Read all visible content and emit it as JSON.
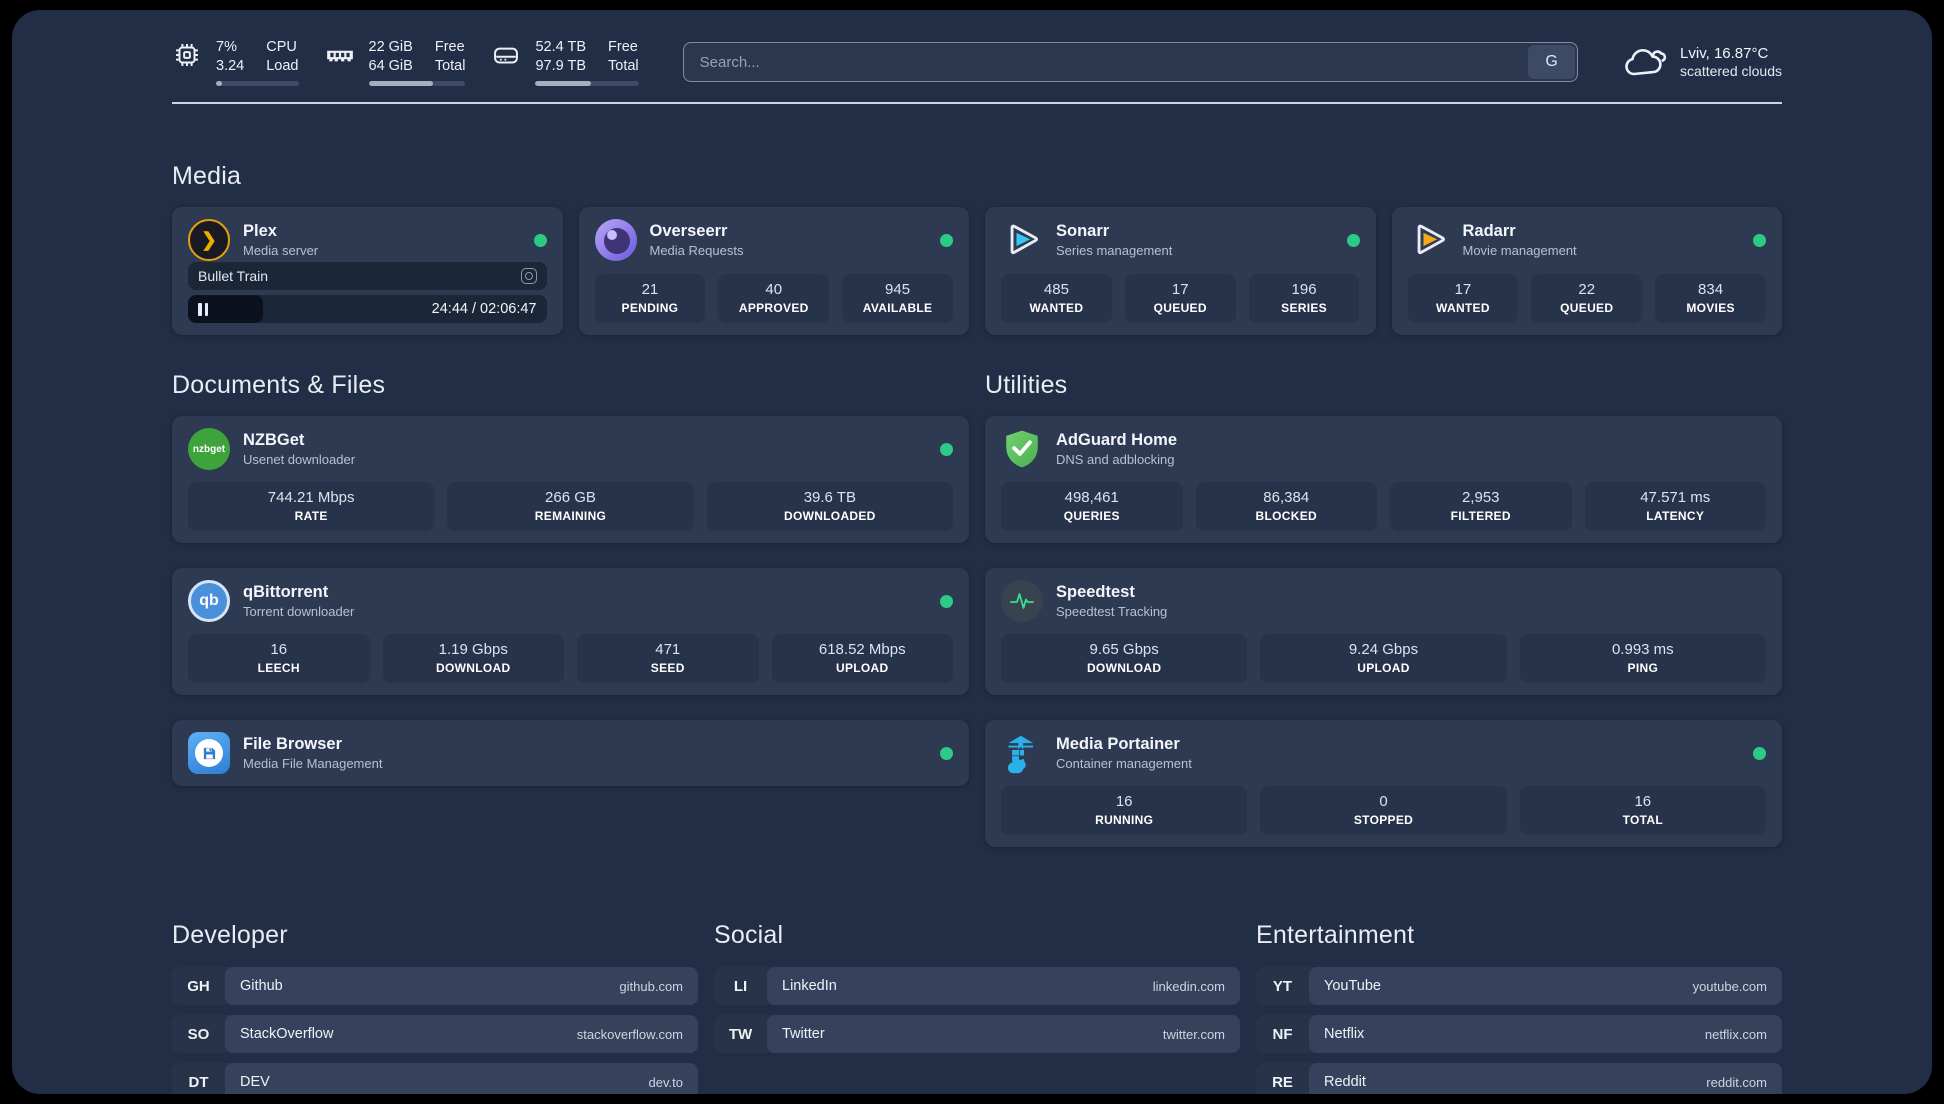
{
  "header": {
    "cpu": {
      "value_top": "7%",
      "value_bottom": "3.24",
      "label_top": "CPU",
      "label_bottom": "Load",
      "percent": 7
    },
    "ram": {
      "value_top": "22 GiB",
      "value_bottom": "64 GiB",
      "label_top": "Free",
      "label_bottom": "Total",
      "percent": 66
    },
    "disk": {
      "value_top": "52.4 TB",
      "value_bottom": "97.9 TB",
      "label_top": "Free",
      "label_bottom": "Total",
      "percent": 54
    },
    "search": {
      "placeholder": "Search...",
      "provider_label": "G"
    },
    "weather": {
      "location_temp": "Lviv, 16.87°C",
      "condition": "scattered clouds"
    }
  },
  "sections": {
    "media": "Media",
    "documents": "Documents & Files",
    "utilities": "Utilities",
    "developer": "Developer",
    "social": "Social",
    "entertainment": "Entertainment"
  },
  "cards": {
    "plex": {
      "name": "Plex",
      "desc": "Media server",
      "icon_glyph": "❯",
      "player": {
        "title": "Bullet Train",
        "time": "24:44 / 02:06:47",
        "progress_percent": 21
      }
    },
    "overseerr": {
      "name": "Overseerr",
      "desc": "Media Requests",
      "stats": [
        {
          "value": "21",
          "label": "PENDING"
        },
        {
          "value": "40",
          "label": "APPROVED"
        },
        {
          "value": "945",
          "label": "AVAILABLE"
        }
      ]
    },
    "sonarr": {
      "name": "Sonarr",
      "desc": "Series management",
      "stats": [
        {
          "value": "485",
          "label": "WANTED"
        },
        {
          "value": "17",
          "label": "QUEUED"
        },
        {
          "value": "196",
          "label": "SERIES"
        }
      ]
    },
    "radarr": {
      "name": "Radarr",
      "desc": "Movie management",
      "stats": [
        {
          "value": "17",
          "label": "WANTED"
        },
        {
          "value": "22",
          "label": "QUEUED"
        },
        {
          "value": "834",
          "label": "MOVIES"
        }
      ]
    },
    "nzbget": {
      "name": "NZBGet",
      "desc": "Usenet downloader",
      "icon_text": "nzbget",
      "stats": [
        {
          "value": "744.21 Mbps",
          "label": "RATE"
        },
        {
          "value": "266 GB",
          "label": "REMAINING"
        },
        {
          "value": "39.6 TB",
          "label": "DOWNLOADED"
        }
      ]
    },
    "qbittorrent": {
      "name": "qBittorrent",
      "desc": "Torrent downloader",
      "icon_text": "qb",
      "stats": [
        {
          "value": "16",
          "label": "LEECH"
        },
        {
          "value": "1.19 Gbps",
          "label": "DOWNLOAD"
        },
        {
          "value": "471",
          "label": "SEED"
        },
        {
          "value": "618.52 Mbps",
          "label": "UPLOAD"
        }
      ]
    },
    "filebrowser": {
      "name": "File Browser",
      "desc": "Media File Management"
    },
    "adguard": {
      "name": "AdGuard Home",
      "desc": "DNS and adblocking",
      "stats": [
        {
          "value": "498,461",
          "label": "QUERIES"
        },
        {
          "value": "86,384",
          "label": "BLOCKED"
        },
        {
          "value": "2,953",
          "label": "FILTERED"
        },
        {
          "value": "47.571 ms",
          "label": "LATENCY"
        }
      ]
    },
    "speedtest": {
      "name": "Speedtest",
      "desc": "Speedtest Tracking",
      "stats": [
        {
          "value": "9.65 Gbps",
          "label": "DOWNLOAD"
        },
        {
          "value": "9.24 Gbps",
          "label": "UPLOAD"
        },
        {
          "value": "0.993 ms",
          "label": "PING"
        }
      ]
    },
    "portainer": {
      "name": "Media Portainer",
      "desc": "Container management",
      "stats": [
        {
          "value": "16",
          "label": "RUNNING"
        },
        {
          "value": "0",
          "label": "STOPPED"
        },
        {
          "value": "16",
          "label": "TOTAL"
        }
      ]
    }
  },
  "bookmarks": {
    "developer": [
      {
        "abbr": "GH",
        "name": "Github",
        "url": "github.com"
      },
      {
        "abbr": "SO",
        "name": "StackOverflow",
        "url": "stackoverflow.com"
      },
      {
        "abbr": "DT",
        "name": "DEV",
        "url": "dev.to"
      }
    ],
    "social": [
      {
        "abbr": "LI",
        "name": "LinkedIn",
        "url": "linkedin.com"
      },
      {
        "abbr": "TW",
        "name": "Twitter",
        "url": "twitter.com"
      }
    ],
    "entertainment": [
      {
        "abbr": "YT",
        "name": "YouTube",
        "url": "youtube.com"
      },
      {
        "abbr": "NF",
        "name": "Netflix",
        "url": "netflix.com"
      },
      {
        "abbr": "RE",
        "name": "Reddit",
        "url": "reddit.com"
      }
    ]
  },
  "colors": {
    "accent_green": "#2bcb87",
    "panel": "#222e45",
    "card": "#2d3a52"
  }
}
